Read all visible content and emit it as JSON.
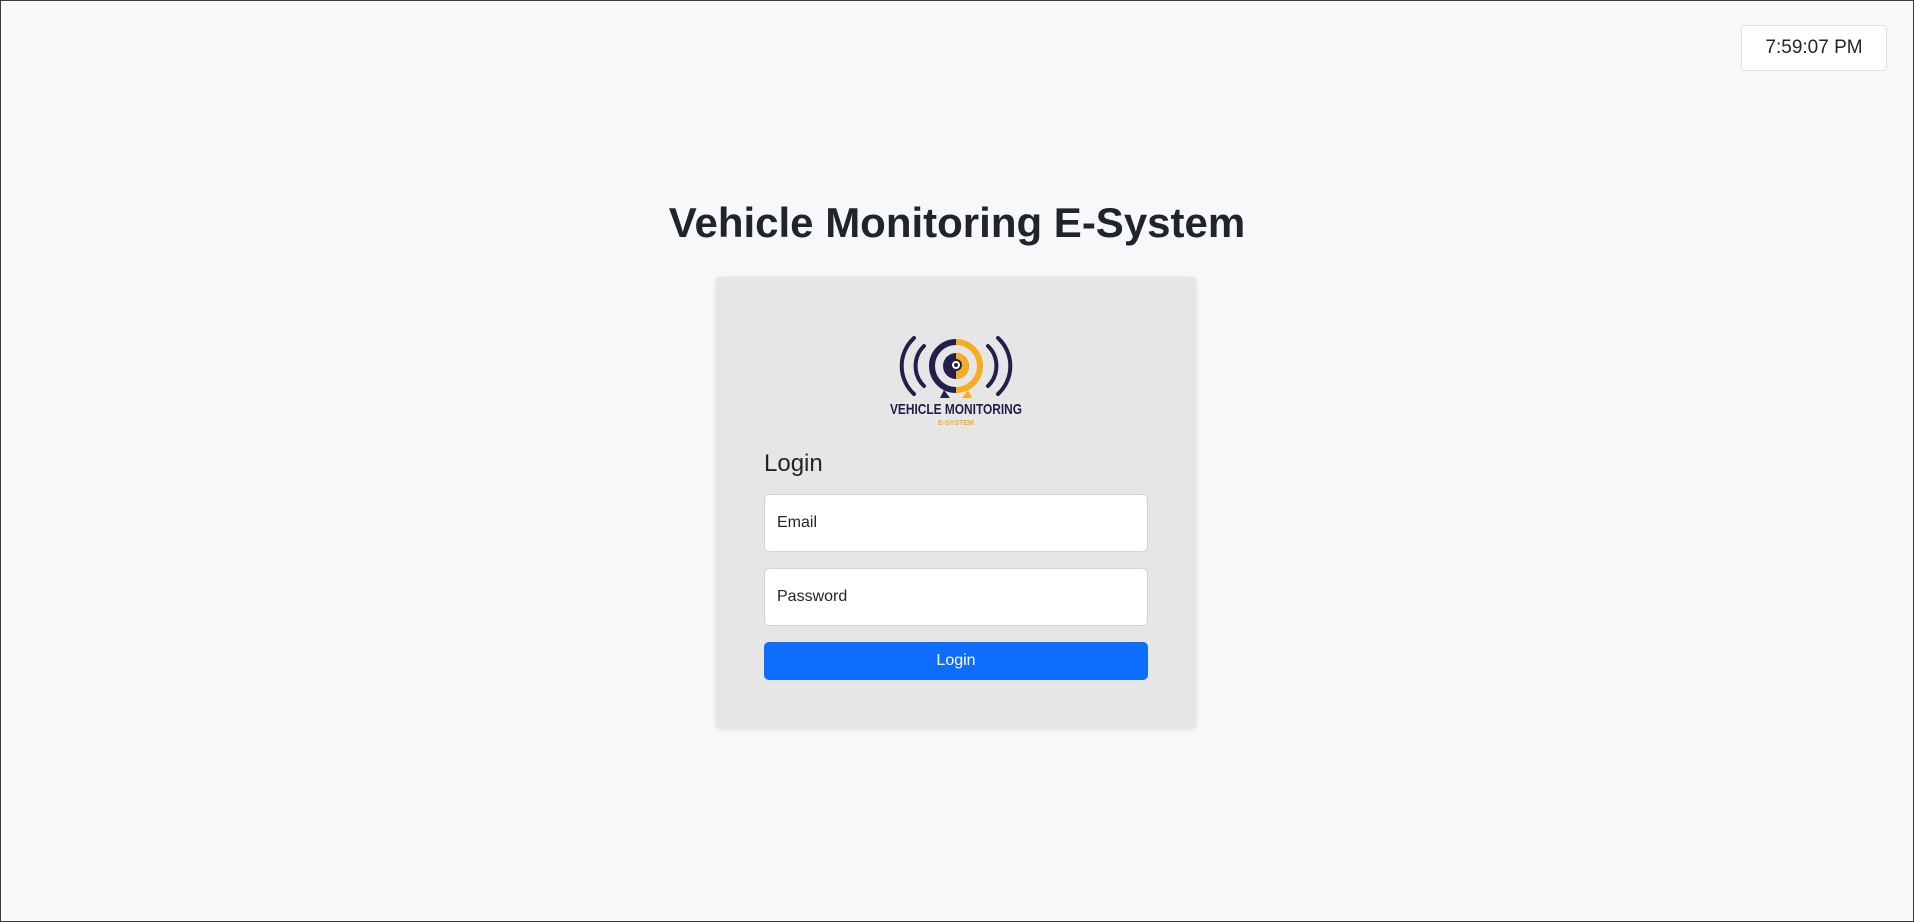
{
  "clock": {
    "time": "7:59:07 PM"
  },
  "header": {
    "title": "Vehicle Monitoring E-System"
  },
  "logo": {
    "text_main": "VEHICLE MONITORING",
    "text_sub": "E-SYSTEM",
    "colors": {
      "navy": "#22204a",
      "gold": "#f5ae20"
    }
  },
  "login": {
    "heading": "Login",
    "email_placeholder": "Email",
    "password_placeholder": "Password",
    "button_label": "Login"
  },
  "colors": {
    "primary": "#0d6efd",
    "background": "#f7f8fa",
    "card_background": "#e6e6e6"
  }
}
